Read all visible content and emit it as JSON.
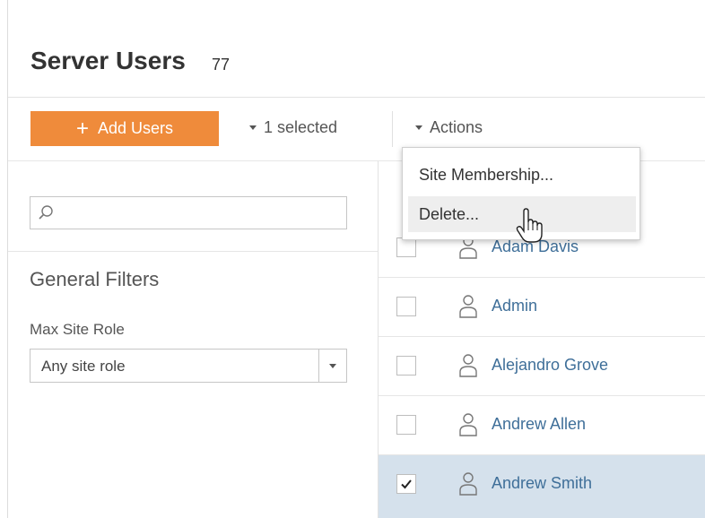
{
  "header": {
    "title": "Server Users",
    "count": "77"
  },
  "toolbar": {
    "add_users_label": "Add Users",
    "selected_label": "1 selected",
    "actions_label": "Actions",
    "accent_color": "#ef8b3b"
  },
  "actions_menu": {
    "items": [
      {
        "label": "Site Membership..."
      },
      {
        "label": "Delete..."
      }
    ],
    "hovered": "Delete..."
  },
  "filters": {
    "search_placeholder": "",
    "search_icon": "search-icon",
    "heading": "General Filters",
    "max_site_role_label": "Max Site Role",
    "max_site_role_value": "Any site role"
  },
  "users": [
    {
      "name": "Adam Davis",
      "checked": false
    },
    {
      "name": "Admin",
      "checked": false
    },
    {
      "name": "Alejandro Grove",
      "checked": false
    },
    {
      "name": "Andrew Allen",
      "checked": false
    },
    {
      "name": "Andrew Smith",
      "checked": true
    }
  ],
  "selected_row_color": "#d5e1ec",
  "user_icon": "user-icon"
}
